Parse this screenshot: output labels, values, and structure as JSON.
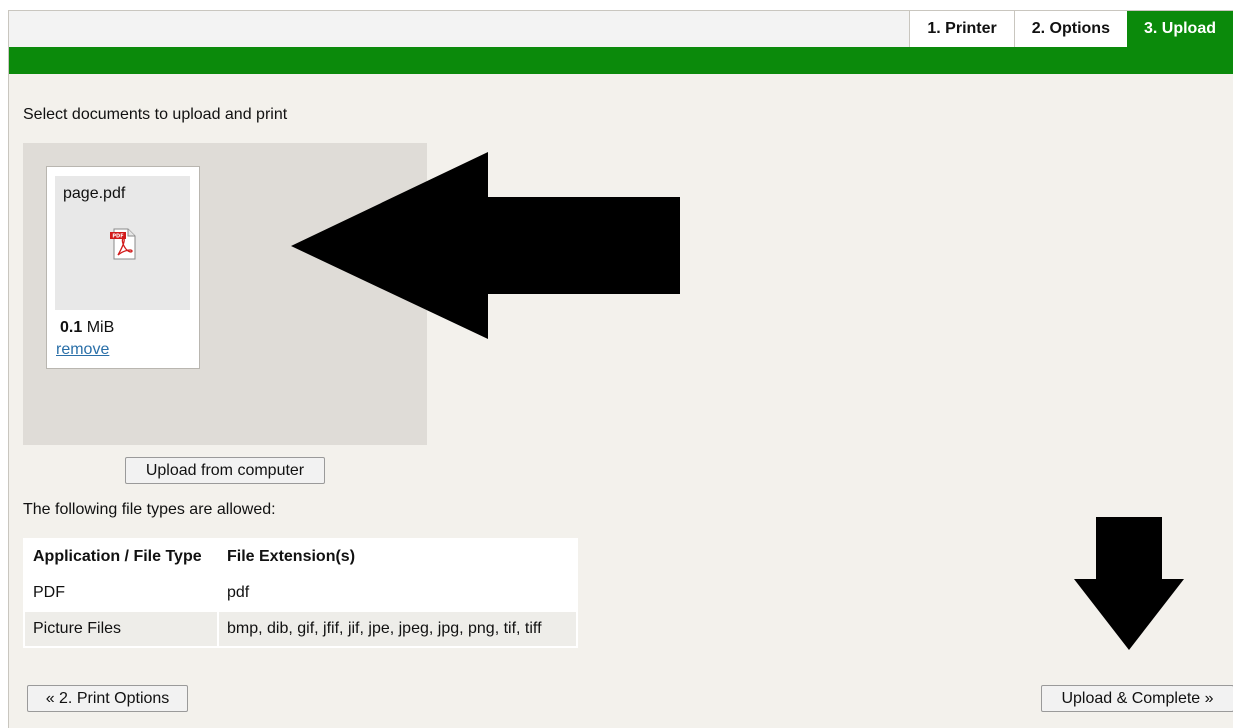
{
  "tabs": [
    {
      "label": "1. Printer",
      "active": false
    },
    {
      "label": "2. Options",
      "active": false
    },
    {
      "label": "3. Upload",
      "active": true
    }
  ],
  "instruction": "Select documents to upload and print",
  "file": {
    "name": "page.pdf",
    "icon": "pdf-file-icon",
    "size_value": "0.1",
    "size_unit": "MiB",
    "remove_label": "remove"
  },
  "upload_button": "Upload from computer",
  "allowed_label": "The following file types are allowed:",
  "file_types": {
    "headers": [
      "Application / File Type",
      "File Extension(s)"
    ],
    "rows": [
      [
        "PDF",
        "pdf"
      ],
      [
        "Picture Files",
        "bmp, dib, gif, jfif, jif, jpe, jpeg, jpg, png, tif, tiff"
      ]
    ]
  },
  "nav": {
    "back_label": "« 2. Print Options",
    "next_label": "Upload & Complete »"
  },
  "colors": {
    "accent": "#0b8a0b",
    "background": "#f3f1ec",
    "dropzone": "#dfdcd7"
  }
}
